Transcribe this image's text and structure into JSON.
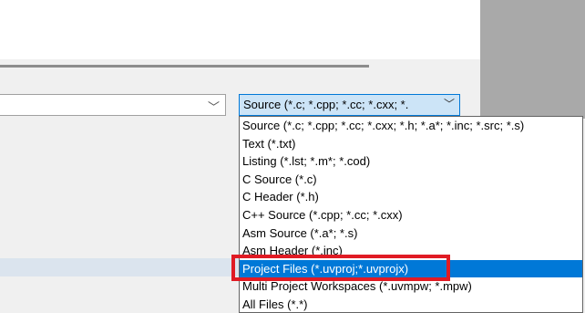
{
  "filename_combo": {
    "value": ""
  },
  "file_type_combo": {
    "selected_label": "Source (*.c; *.cpp; *.cc; *.cxx; *."
  },
  "file_type_options": [
    "Source (*.c; *.cpp; *.cc; *.cxx; *.h; *.a*; *.inc; *.src; *.s)",
    "Text (*.txt)",
    "Listing (*.lst; *.m*; *.cod)",
    "C Source (*.c)",
    "C Header (*.h)",
    "C++ Source (*.cpp; *.cc; *.cxx)",
    "Asm Source (*.a*; *.s)",
    "Asm Header (*.inc)",
    "Project Files (*.uvproj;*.uvprojx)",
    "Multi Project Workspaces (*.uvmpw; *.mpw)",
    "All Files (*.*)"
  ],
  "selected_index": 8,
  "icons": {
    "dropdown_arrow": "chevron-down-icon"
  },
  "colors": {
    "selection": "#0078d7",
    "annotation": "#e01b24"
  }
}
